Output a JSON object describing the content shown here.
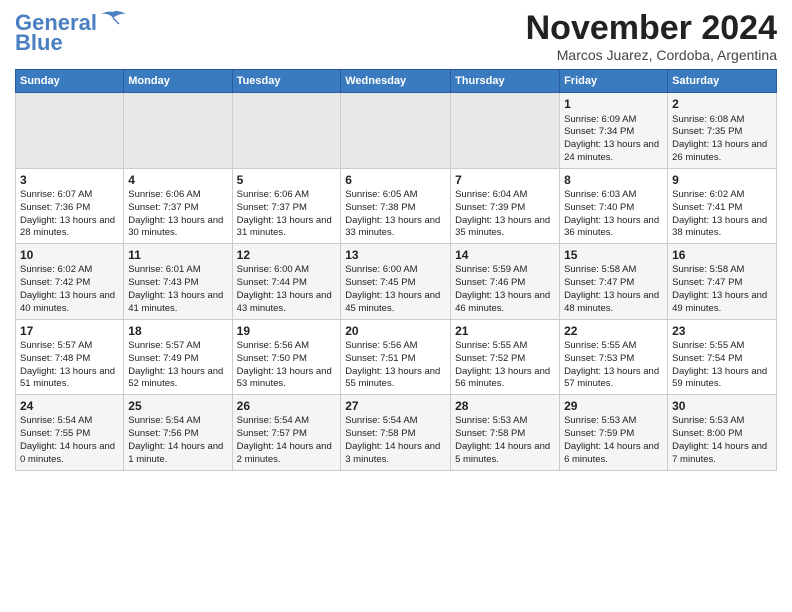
{
  "logo": {
    "line1": "General",
    "line2": "Blue"
  },
  "title": "November 2024",
  "location": "Marcos Juarez, Cordoba, Argentina",
  "days_of_week": [
    "Sunday",
    "Monday",
    "Tuesday",
    "Wednesday",
    "Thursday",
    "Friday",
    "Saturday"
  ],
  "weeks": [
    [
      {
        "day": "",
        "empty": true
      },
      {
        "day": "",
        "empty": true
      },
      {
        "day": "",
        "empty": true
      },
      {
        "day": "",
        "empty": true
      },
      {
        "day": "",
        "empty": true
      },
      {
        "day": "1",
        "sunrise": "6:09 AM",
        "sunset": "7:34 PM",
        "daylight": "13 hours and 24 minutes."
      },
      {
        "day": "2",
        "sunrise": "6:08 AM",
        "sunset": "7:35 PM",
        "daylight": "13 hours and 26 minutes."
      }
    ],
    [
      {
        "day": "3",
        "sunrise": "6:07 AM",
        "sunset": "7:36 PM",
        "daylight": "13 hours and 28 minutes."
      },
      {
        "day": "4",
        "sunrise": "6:06 AM",
        "sunset": "7:37 PM",
        "daylight": "13 hours and 30 minutes."
      },
      {
        "day": "5",
        "sunrise": "6:06 AM",
        "sunset": "7:37 PM",
        "daylight": "13 hours and 31 minutes."
      },
      {
        "day": "6",
        "sunrise": "6:05 AM",
        "sunset": "7:38 PM",
        "daylight": "13 hours and 33 minutes."
      },
      {
        "day": "7",
        "sunrise": "6:04 AM",
        "sunset": "7:39 PM",
        "daylight": "13 hours and 35 minutes."
      },
      {
        "day": "8",
        "sunrise": "6:03 AM",
        "sunset": "7:40 PM",
        "daylight": "13 hours and 36 minutes."
      },
      {
        "day": "9",
        "sunrise": "6:02 AM",
        "sunset": "7:41 PM",
        "daylight": "13 hours and 38 minutes."
      }
    ],
    [
      {
        "day": "10",
        "sunrise": "6:02 AM",
        "sunset": "7:42 PM",
        "daylight": "13 hours and 40 minutes."
      },
      {
        "day": "11",
        "sunrise": "6:01 AM",
        "sunset": "7:43 PM",
        "daylight": "13 hours and 41 minutes."
      },
      {
        "day": "12",
        "sunrise": "6:00 AM",
        "sunset": "7:44 PM",
        "daylight": "13 hours and 43 minutes."
      },
      {
        "day": "13",
        "sunrise": "6:00 AM",
        "sunset": "7:45 PM",
        "daylight": "13 hours and 45 minutes."
      },
      {
        "day": "14",
        "sunrise": "5:59 AM",
        "sunset": "7:46 PM",
        "daylight": "13 hours and 46 minutes."
      },
      {
        "day": "15",
        "sunrise": "5:58 AM",
        "sunset": "7:47 PM",
        "daylight": "13 hours and 48 minutes."
      },
      {
        "day": "16",
        "sunrise": "5:58 AM",
        "sunset": "7:47 PM",
        "daylight": "13 hours and 49 minutes."
      }
    ],
    [
      {
        "day": "17",
        "sunrise": "5:57 AM",
        "sunset": "7:48 PM",
        "daylight": "13 hours and 51 minutes."
      },
      {
        "day": "18",
        "sunrise": "5:57 AM",
        "sunset": "7:49 PM",
        "daylight": "13 hours and 52 minutes."
      },
      {
        "day": "19",
        "sunrise": "5:56 AM",
        "sunset": "7:50 PM",
        "daylight": "13 hours and 53 minutes."
      },
      {
        "day": "20",
        "sunrise": "5:56 AM",
        "sunset": "7:51 PM",
        "daylight": "13 hours and 55 minutes."
      },
      {
        "day": "21",
        "sunrise": "5:55 AM",
        "sunset": "7:52 PM",
        "daylight": "13 hours and 56 minutes."
      },
      {
        "day": "22",
        "sunrise": "5:55 AM",
        "sunset": "7:53 PM",
        "daylight": "13 hours and 57 minutes."
      },
      {
        "day": "23",
        "sunrise": "5:55 AM",
        "sunset": "7:54 PM",
        "daylight": "13 hours and 59 minutes."
      }
    ],
    [
      {
        "day": "24",
        "sunrise": "5:54 AM",
        "sunset": "7:55 PM",
        "daylight": "14 hours and 0 minutes."
      },
      {
        "day": "25",
        "sunrise": "5:54 AM",
        "sunset": "7:56 PM",
        "daylight": "14 hours and 1 minute."
      },
      {
        "day": "26",
        "sunrise": "5:54 AM",
        "sunset": "7:57 PM",
        "daylight": "14 hours and 2 minutes."
      },
      {
        "day": "27",
        "sunrise": "5:54 AM",
        "sunset": "7:58 PM",
        "daylight": "14 hours and 3 minutes."
      },
      {
        "day": "28",
        "sunrise": "5:53 AM",
        "sunset": "7:58 PM",
        "daylight": "14 hours and 5 minutes."
      },
      {
        "day": "29",
        "sunrise": "5:53 AM",
        "sunset": "7:59 PM",
        "daylight": "14 hours and 6 minutes."
      },
      {
        "day": "30",
        "sunrise": "5:53 AM",
        "sunset": "8:00 PM",
        "daylight": "14 hours and 7 minutes."
      }
    ]
  ],
  "labels": {
    "sunrise": "Sunrise:",
    "sunset": "Sunset:",
    "daylight": "Daylight:"
  }
}
